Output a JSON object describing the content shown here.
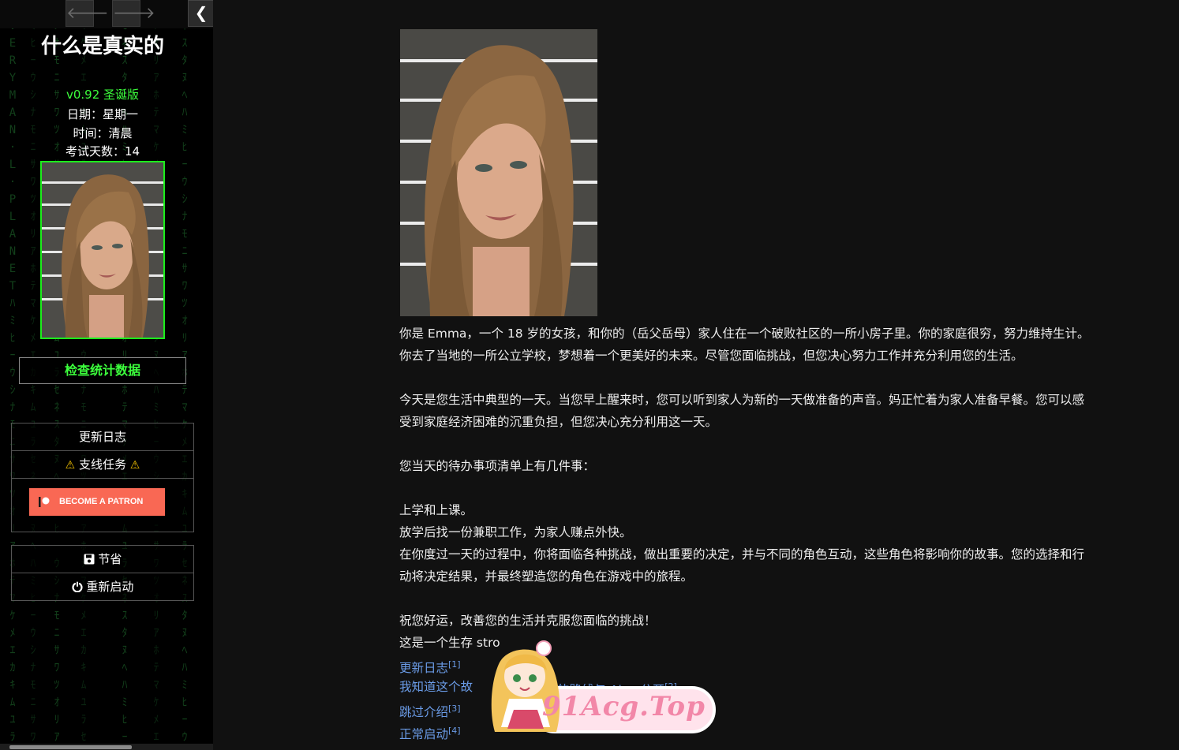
{
  "sidebar": {
    "nav": {
      "back_icon": "arrow-left-icon",
      "forward_icon": "arrow-right-icon",
      "collapse_icon": "chevron-left-icon"
    },
    "title": "什么是真实的",
    "version": "v0.92 圣诞版",
    "day": "日期：星期一",
    "time": "时间：清晨",
    "exam_days": "考试天数：14",
    "stats_button": "检查统计数据",
    "menu": {
      "changelog": "更新日志",
      "side_quests": "支线任务",
      "patron_button": "BECOME A PATRON"
    },
    "save_label": "节省",
    "restart_label": "重新启动",
    "rain_text": "EVERYMAN·L·PLANET"
  },
  "main": {
    "paragraphs": [
      "你是 Emma，一个 18 岁的女孩，和你的（岳父岳母）家人住在一个破败社区的一所小房子里。你的家庭很穷，努力维持生计。你去了当地的一所公立学校，梦想着一个更美好的未来。尽管您面临挑战，但您决心努力工作并充分利用您的生活。",
      "今天是您生活中典型的一天。当您早上醒来时，您可以听到家人为新的一天做准备的声音。妈正忙着为家人准备早餐。您可以感受到家庭经济困难的沉重负担，但您决心充分利用这一天。",
      "您当天的待办事项清单上有几件事：",
      "上学和上课。",
      "放学后找一份兼职工作，为家人赚点外快。",
      "在你度过一天的过程中，你将面临各种挑战，做出重要的决定，并与不同的角色互动，这些角色将影响你的故事。您的选择和行动将决定结果，并最终塑造您的角色在游戏中的旅程。",
      "祝您好运，改善您的生活并克服您面临的挑战！",
      "这是一个生存 stro"
    ],
    "links": [
      {
        "label": "更新日志",
        "ref": "[1]"
      },
      {
        "label": "我知道这个故",
        "ref": ""
      },
      {
        "label": "的路线与 Alex 公开",
        "ref": "[2]"
      },
      {
        "label": "跳过介绍",
        "ref": "[3]"
      },
      {
        "label": "正常启动",
        "ref": "[4]"
      }
    ]
  },
  "watermark": {
    "text": "91Acg.Top"
  },
  "colors": {
    "accent_green": "#1cee1c",
    "link": "#6a9be6",
    "patron": "#f96854",
    "background": "#111111"
  }
}
